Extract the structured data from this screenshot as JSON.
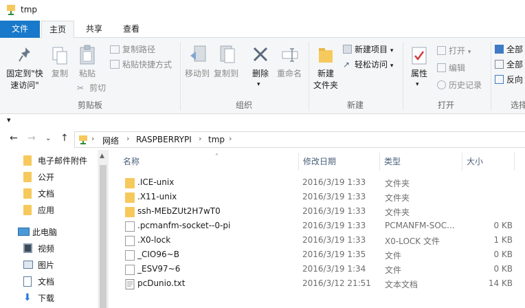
{
  "window": {
    "title": "tmp"
  },
  "tabs": {
    "file": "文件",
    "home": "主页",
    "share": "共享",
    "view": "查看"
  },
  "ribbon": {
    "clipboard": {
      "label": "剪贴板",
      "pin_line1": "固定到\"快",
      "pin_line2": "速访问\"",
      "copy": "复制",
      "paste": "粘贴",
      "copy_path": "复制路径",
      "paste_shortcut": "粘贴快捷方式",
      "cut": "剪切"
    },
    "organize": {
      "label": "组织",
      "move_to": "移动到",
      "copy_to": "复制到",
      "delete": "删除",
      "rename": "重命名"
    },
    "new": {
      "label": "新建",
      "new_folder_line1": "新建",
      "new_folder_line2": "文件夹",
      "new_item": "新建项目",
      "easy_access": "轻松访问"
    },
    "open": {
      "label": "打开",
      "properties": "属性",
      "open": "打开",
      "edit": "编辑",
      "history": "历史记录"
    },
    "select": {
      "label": "选择",
      "select_all": "全部",
      "select_none": "全部",
      "invert": "反向"
    }
  },
  "qat": {
    "arrow": "▾"
  },
  "address": {
    "crumbs": [
      "网络",
      "RASPBERRYPI",
      "tmp"
    ]
  },
  "navpane": {
    "items": [
      {
        "label": "电子邮件附件",
        "icon": "folder-icon"
      },
      {
        "label": "公开",
        "icon": "folder-icon"
      },
      {
        "label": "文档",
        "icon": "folder-icon"
      },
      {
        "label": "应用",
        "icon": "folder-icon"
      },
      {
        "label": "此电脑",
        "icon": "computer-icon"
      },
      {
        "label": "视频",
        "icon": "video-icon"
      },
      {
        "label": "图片",
        "icon": "pictures-icon"
      },
      {
        "label": "文档",
        "icon": "documents-icon"
      },
      {
        "label": "下载",
        "icon": "download-icon"
      }
    ]
  },
  "filelist": {
    "columns": {
      "name": "名称",
      "date": "修改日期",
      "type": "类型",
      "size": "大小"
    },
    "rows": [
      {
        "name": ".ICE-unix",
        "date": "2016/3/19 1:33",
        "type": "文件夹",
        "size": "",
        "icon": "folder-icon"
      },
      {
        "name": ".X11-unix",
        "date": "2016/3/19 1:33",
        "type": "文件夹",
        "size": "",
        "icon": "folder-icon"
      },
      {
        "name": "ssh-MEbZUt2H7wT0",
        "date": "2016/3/19 1:33",
        "type": "文件夹",
        "size": "",
        "icon": "folder-icon"
      },
      {
        "name": ".pcmanfm-socket--0-pi",
        "date": "2016/3/19 1:33",
        "type": "PCMANFM-SOC...",
        "size": "0 KB",
        "icon": "file-icon"
      },
      {
        "name": ".X0-lock",
        "date": "2016/3/19 1:33",
        "type": "X0-LOCK 文件",
        "size": "1 KB",
        "icon": "file-icon"
      },
      {
        "name": "_CIO96~B",
        "date": "2016/3/19 1:35",
        "type": "文件",
        "size": "0 KB",
        "icon": "file-icon"
      },
      {
        "name": "_ESV97~6",
        "date": "2016/3/19 1:34",
        "type": "文件",
        "size": "0 KB",
        "icon": "file-icon"
      },
      {
        "name": "pcDunio.txt",
        "date": "2016/3/12 21:51",
        "type": "文本文档",
        "size": "14 KB",
        "icon": "text-file-icon"
      }
    ]
  },
  "colors": {
    "accent": "#1979ca",
    "ribbon_bg": "#f5f6f7",
    "folder": "#f6c95c"
  }
}
